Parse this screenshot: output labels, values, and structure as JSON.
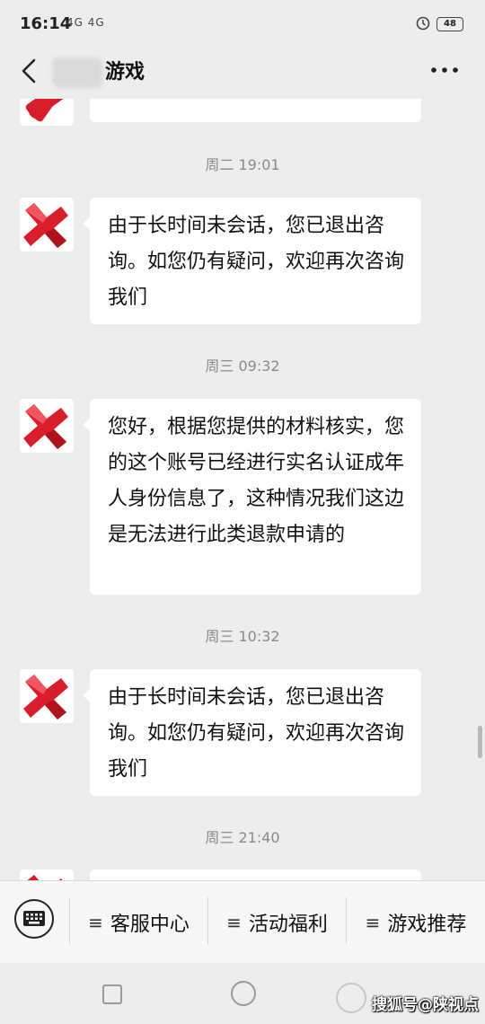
{
  "status_bar": {
    "time": "16:14",
    "signal_text": "4G 4G",
    "battery": "48"
  },
  "header": {
    "title": "游戏"
  },
  "chat": {
    "messages": [
      {
        "timestamp": "周二 19:01",
        "text": "由于长时间未会话，您已退出咨询。如您仍有疑问，欢迎再次咨询我们"
      },
      {
        "timestamp": "周三 09:32",
        "text": "您好，根据您提供的材料核实，您的这个账号已经进行实名认证成年人身份信息了，这种情况我们这边是无法进行此类退款申请的"
      },
      {
        "timestamp": "周三 10:32",
        "text": "由于长时间未会话，您已退出咨询。如您仍有疑问，欢迎再次咨询我们"
      },
      {
        "timestamp": "周三 21:40"
      }
    ]
  },
  "menu": {
    "items": [
      {
        "icon": "≡",
        "label": "客服中心"
      },
      {
        "icon": "≡",
        "label": "活动福利"
      },
      {
        "icon": "≡",
        "label": "游戏推荐"
      }
    ]
  },
  "watermark": {
    "text": "搜狐号@陕视点"
  },
  "colors": {
    "background": "#ededed",
    "bubble": "#ffffff",
    "avatar_red": "#d81e2a"
  }
}
